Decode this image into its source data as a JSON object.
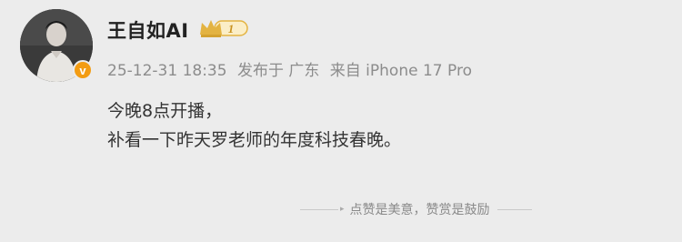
{
  "user": {
    "name": "王自如AI",
    "level": "1",
    "verified_mark": "v",
    "avatar_icon": "avatar-photo"
  },
  "meta": {
    "date": "25-12-31 18:35",
    "posted_from": "发布于 广东",
    "device": "来自 iPhone 17 Pro"
  },
  "content": {
    "lines": [
      "今晚8点开播，",
      "补看一下昨天罗老师的年度科技春晚。"
    ]
  },
  "footer": {
    "reward_text": "点赞是美意，赞赏是鼓励"
  },
  "colors": {
    "background": "#ececec",
    "meta_text": "#8c8c8c",
    "badge_gold": "#e3b341",
    "verified": "#f39c12"
  }
}
